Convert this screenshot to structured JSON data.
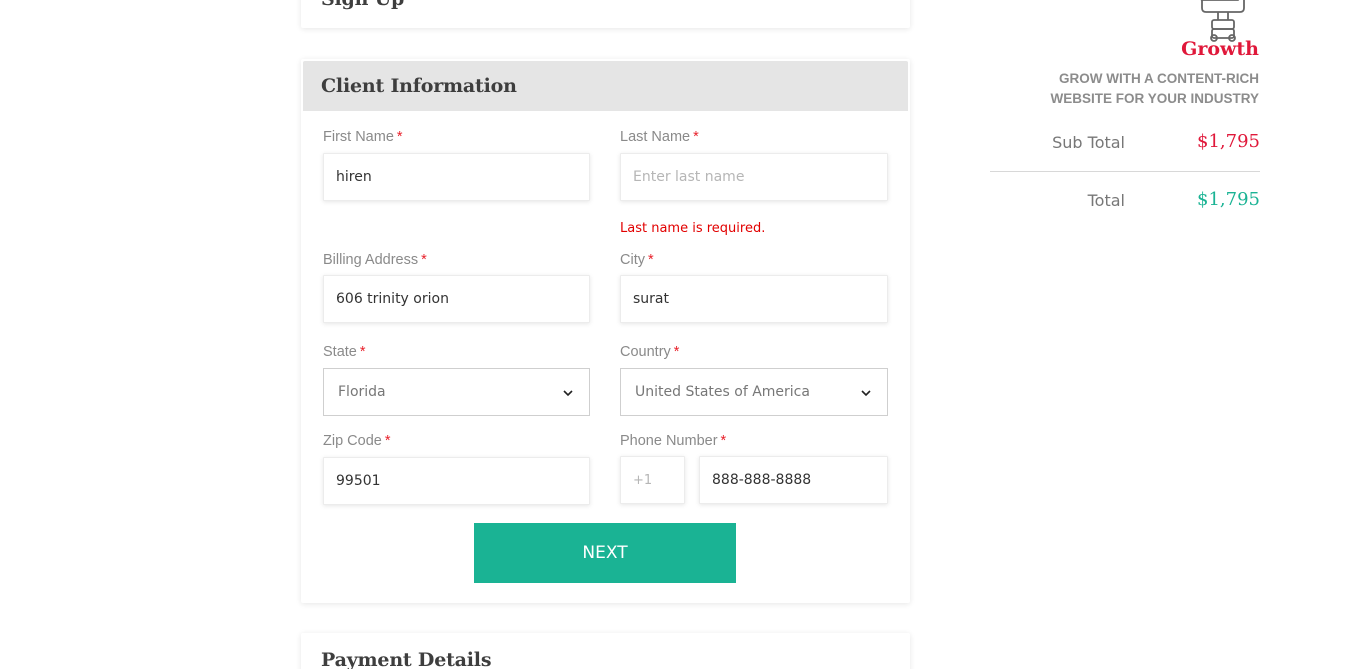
{
  "signup": {
    "title": "Sign Up"
  },
  "client_info": {
    "title": "Client Information",
    "required_marker": "*",
    "fields": {
      "first_name": {
        "label": "First Name",
        "value": "hiren"
      },
      "last_name": {
        "label": "Last Name",
        "placeholder": "Enter last name",
        "error": "Last name is required."
      },
      "billing_address": {
        "label": "Billing Address",
        "value": "606 trinity orion"
      },
      "city": {
        "label": "City",
        "value": "surat"
      },
      "state": {
        "label": "State",
        "selected": "Florida"
      },
      "country": {
        "label": "Country",
        "selected": "United States of America"
      },
      "zip": {
        "label": "Zip Code",
        "value": "99501"
      },
      "phone": {
        "label": "Phone Number",
        "prefix": "+1",
        "value": "888-888-8888"
      }
    },
    "next_label": "NEXT"
  },
  "payment": {
    "title": "Payment Details"
  },
  "summary": {
    "plan_icon": "cart-icon",
    "plan_name": "Growth",
    "plan_desc_line1": "GROW WITH A CONTENT-RICH",
    "plan_desc_line2": "WEBSITE FOR YOUR INDUSTRY",
    "sub_total_label": "Sub Total",
    "sub_total_value": "$1,795",
    "total_label": "Total",
    "total_value": "$1,795"
  },
  "colors": {
    "accent": "#1ab394",
    "plan_red": "#e0183a",
    "error": "#e20000",
    "total_green": "#1ab394"
  }
}
